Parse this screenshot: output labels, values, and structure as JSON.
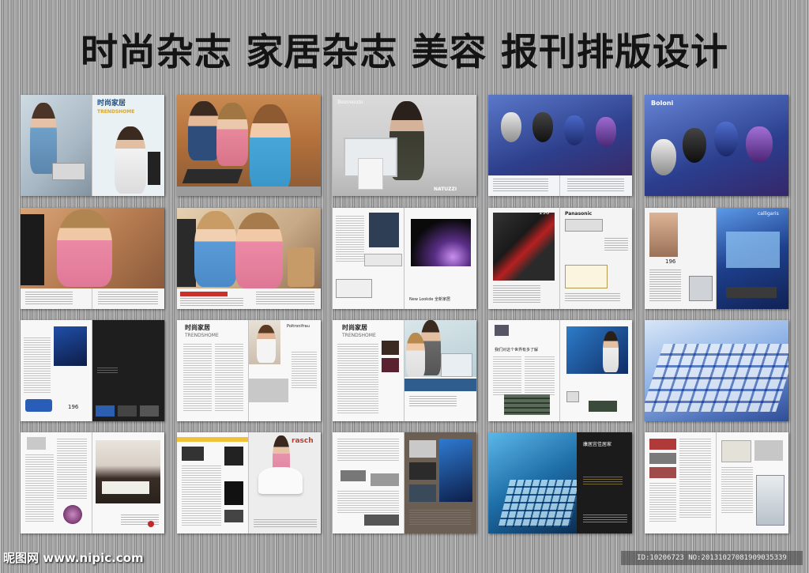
{
  "headline": "时尚杂志 家居杂志 美容 报刊排版设计",
  "colors": {
    "background": "#a9a9a9",
    "headline": "#141414",
    "dark_page": "#1e1e1e",
    "blue_accent": "#3a5fb0"
  },
  "spreads": {
    "r1c1": {
      "title": "时尚家居",
      "subtitle": "TRENDSHOME"
    },
    "r1c3": {
      "brand_top": "Benvenuto",
      "brand_bottom": "NATUZZI"
    },
    "r1c5": {
      "brand": "Boloni"
    },
    "r2c3": {
      "brand": "New Lookde 全新家居"
    },
    "r2c4": {
      "brand": "Panasonic",
      "page_number": "196"
    },
    "r2c5": {
      "page_number": "196",
      "brand": "calligaris"
    },
    "r3c1": {
      "page_number": "196"
    },
    "r3c2": {
      "title": "时尚家居",
      "subtitle": "TRENDSHOME",
      "brand": "Poltronifrau"
    },
    "r3c3": {
      "title": "时尚家居",
      "subtitle": "TRENDSHOME"
    },
    "r3c4": {
      "heading": "我们对这个世界有多了解"
    },
    "r4c2": {
      "brand": "rasch"
    },
    "r4c4": {
      "title": "康居宜佳居家"
    }
  },
  "footer": {
    "site": "昵图网 www.nipic.com",
    "id_text": "ID:10206723 NO:20131027081909035339"
  }
}
